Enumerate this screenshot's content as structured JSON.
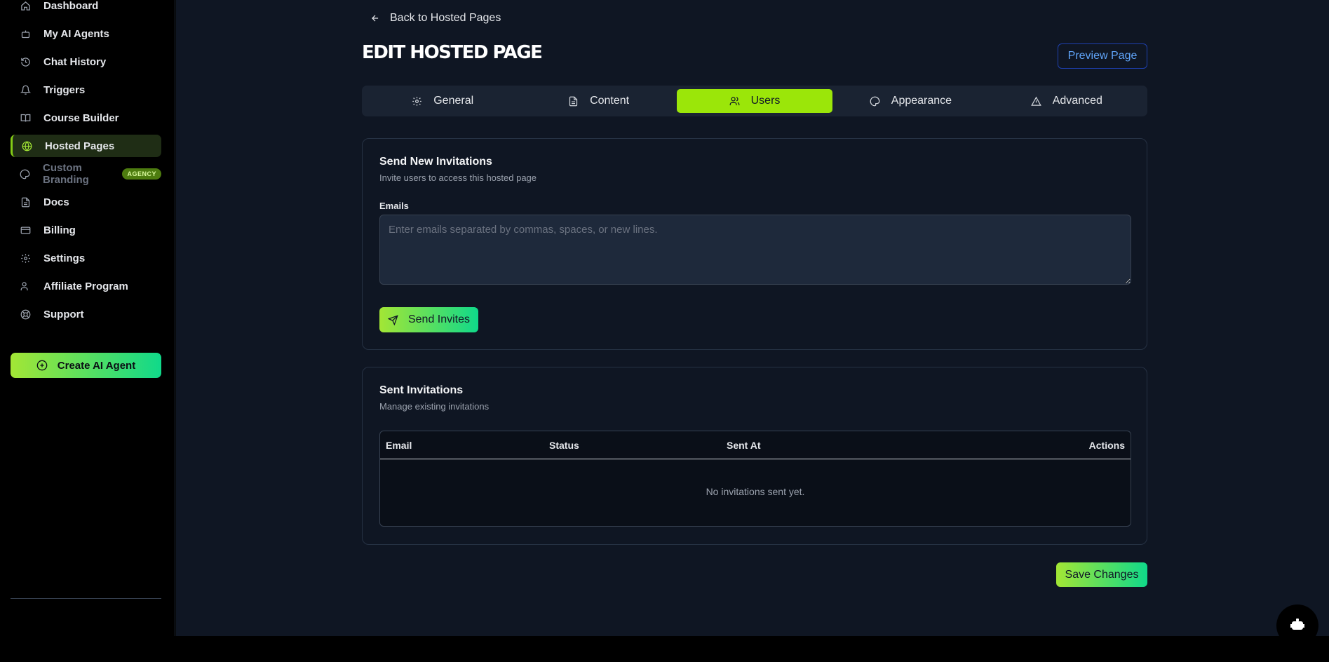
{
  "sidebar": {
    "items": [
      {
        "label": "Dashboard",
        "icon": "home-icon"
      },
      {
        "label": "My AI Agents",
        "icon": "bot-icon"
      },
      {
        "label": "Chat History",
        "icon": "history-icon"
      },
      {
        "label": "Triggers",
        "icon": "bell-icon"
      },
      {
        "label": "Course Builder",
        "icon": "book-icon"
      },
      {
        "label": "Hosted Pages",
        "icon": "globe-icon"
      },
      {
        "label": "Custom Branding",
        "icon": "palette-icon",
        "badge": "AGENCY"
      },
      {
        "label": "Docs",
        "icon": "document-icon"
      },
      {
        "label": "Billing",
        "icon": "credit-card-icon"
      },
      {
        "label": "Settings",
        "icon": "gear-icon"
      },
      {
        "label": "Affiliate Program",
        "icon": "users-icon"
      },
      {
        "label": "Support",
        "icon": "lifebuoy-icon"
      }
    ],
    "create_button": "Create AI Agent"
  },
  "header": {
    "back_link": "Back to Hosted Pages",
    "title": "EDIT HOSTED PAGE",
    "preview_button": "Preview Page"
  },
  "tabs": [
    {
      "label": "General",
      "icon": "gear-icon"
    },
    {
      "label": "Content",
      "icon": "document-icon"
    },
    {
      "label": "Users",
      "icon": "users-icon",
      "active": true
    },
    {
      "label": "Appearance",
      "icon": "palette-icon"
    },
    {
      "label": "Advanced",
      "icon": "warning-icon"
    }
  ],
  "invite_card": {
    "title": "Send New Invitations",
    "subtitle": "Invite users to access this hosted page",
    "emails_label": "Emails",
    "emails_value": "",
    "emails_placeholder": "Enter emails separated by commas, spaces, or new lines.",
    "send_button": "Send Invites"
  },
  "sent_card": {
    "title": "Sent Invitations",
    "subtitle": "Manage existing invitations",
    "columns": [
      "Email",
      "Status",
      "Sent At",
      "Actions"
    ],
    "rows": [],
    "empty_text": "No invitations sent yet."
  },
  "save_button": "Save Changes",
  "colors": {
    "accent": "#9be609",
    "accent_gradient_end": "#10d98a",
    "link": "#60a5fa",
    "bg": "#0f1623"
  }
}
